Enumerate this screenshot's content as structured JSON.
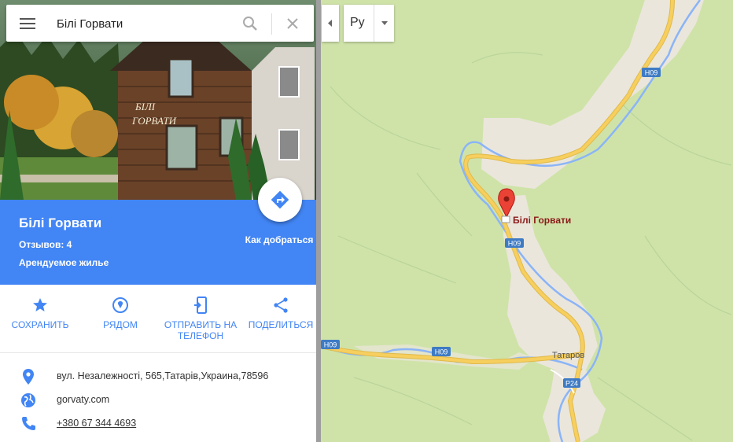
{
  "search": {
    "value": "Білі Горвати"
  },
  "place": {
    "title": "Білі Горвати",
    "reviews": "Отзывов: 4",
    "type": "Арендуемое жилье",
    "directions_label": "Как добраться",
    "sign_line1": "БІЛІ",
    "sign_line2": "ГОРВАТИ"
  },
  "actions": [
    {
      "label": "СОХРАНИТЬ",
      "icon": "star-icon"
    },
    {
      "label": "РЯДОМ",
      "icon": "nearby-icon"
    },
    {
      "label": "ОТПРАВИТЬ НА ТЕЛЕФОН",
      "icon": "send-to-phone-icon"
    },
    {
      "label": "ПОДЕЛИТЬСЯ",
      "icon": "share-icon"
    }
  ],
  "details": {
    "address": "вул. Незалежності, 565,Татарів,Украина,78596",
    "website": "gorvaty.com",
    "phone": "+380 67 344 4693"
  },
  "map": {
    "language": "Ру",
    "place_label": "Білі Горвати",
    "town_label": "Татаров",
    "roads": [
      "H09",
      "H09",
      "H09",
      "H09",
      "P24"
    ]
  },
  "colors": {
    "accent": "#4285f4",
    "map_green": "#cfe3a9",
    "road_yellow": "#f6cf5f",
    "marker_red": "#ea4335"
  }
}
